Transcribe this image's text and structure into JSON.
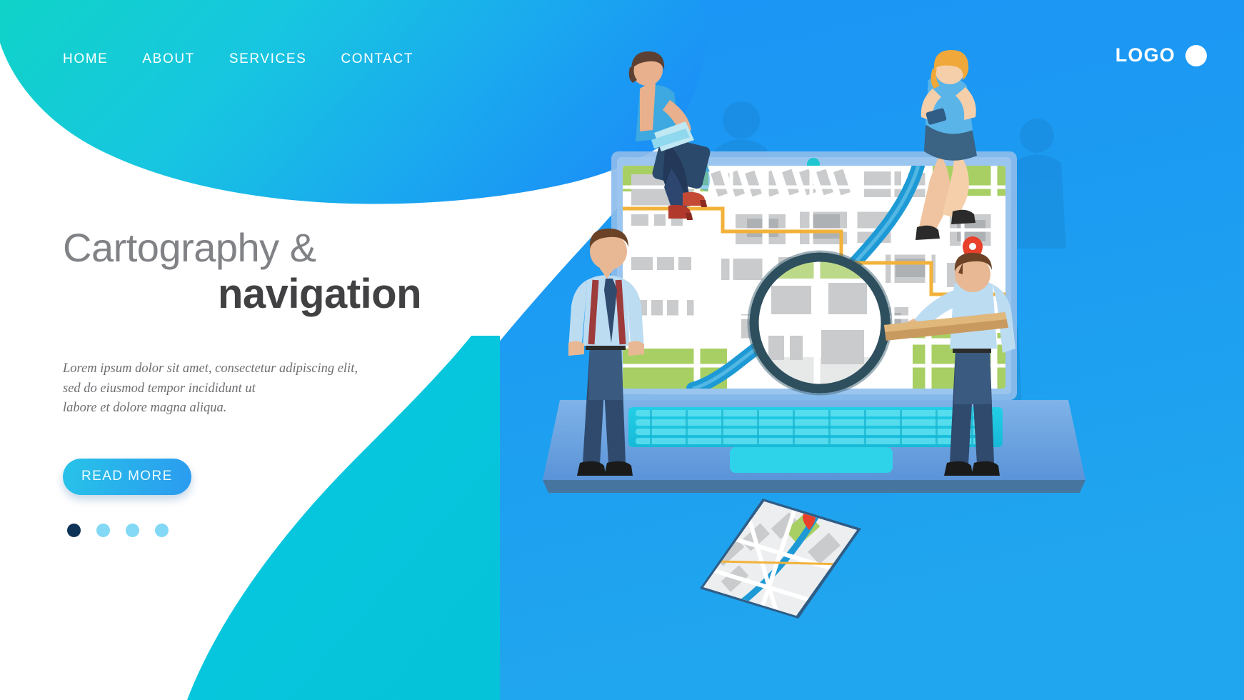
{
  "page": {
    "kind": "landing-page-hero",
    "background": {
      "white": "#ffffff",
      "blob_teal": "#10d0d8",
      "blob_blue": "#1b95f5",
      "right_blue": "#1c97f3",
      "bottom_teal": "#06c5dd"
    }
  },
  "nav": {
    "items": [
      {
        "label": "HOME"
      },
      {
        "label": "ABOUT"
      },
      {
        "label": "SERVICES"
      },
      {
        "label": "CONTACT"
      }
    ]
  },
  "brand": {
    "logo_text": "LOGO",
    "logo_mark": "circle-icon",
    "color": "#ffffff"
  },
  "hero": {
    "title_line1": "Cartography &",
    "title_line2": "navigation",
    "title_line1_color": "#808285",
    "title_line2_color": "#414042",
    "paragraph_lines": [
      "Lorem ipsum dolor sit amet, consectetur adipiscing elit,",
      "sed do eiusmod tempor incididunt ut",
      "labore et dolore magna aliqua."
    ],
    "cta_label": "READ MORE",
    "cta_gradient_from": "#27c3e8",
    "cta_gradient_to": "#2b9bf0",
    "carousel": {
      "total": 4,
      "active_index": 0,
      "active_color": "#0d3356",
      "inactive_color": "#82d8f5"
    }
  },
  "illustration": {
    "name": "cartography-navigation-isometric-scene",
    "devices": [
      {
        "name": "laptop",
        "screen_content": "city-street-map",
        "webcam": "teal-dot",
        "keyboard_color": "#19c6e0",
        "base_color": "#5f9fe0"
      },
      {
        "name": "smartphone",
        "screen_content": "city-street-map",
        "orientation": "isometric-tilted"
      }
    ],
    "characters": [
      {
        "name": "woman-with-laptop",
        "position": "sitting-top-left-of-laptop",
        "hair": "#6b4a3a",
        "shirt": "#3da9e0",
        "shoes": "#b03a2e"
      },
      {
        "name": "woman-with-phone",
        "position": "sitting-top-right-of-laptop",
        "hair": "#f0a83a",
        "shirt": "#5ab4e8",
        "skirt": "#3a5a7a"
      },
      {
        "name": "man-with-suspenders",
        "position": "standing-left",
        "shirt": "#b8d8ef",
        "tie": "#2f4a6d",
        "trousers": "#2f4a6d"
      },
      {
        "name": "man-with-magnifier",
        "position": "standing-right",
        "shirt": "#b8d8ef",
        "trousers": "#2f4a6d"
      }
    ],
    "map": {
      "road_color": "#ffffff",
      "building_color": "#c9cbcd",
      "building_color_dark": "#a9acaf",
      "river_color": "#1d9ad6",
      "park_color": "#a8cf63",
      "route_color": "#f2b23a",
      "pin_color": "#e8402a",
      "pin_icon": "map-pin-icon"
    },
    "props": [
      {
        "name": "magnifying-glass-icon",
        "lens_color": "#ffffff",
        "rim_color": "#2e4f5e"
      },
      {
        "name": "map-pin-icon",
        "color": "#e8402a"
      }
    ]
  }
}
